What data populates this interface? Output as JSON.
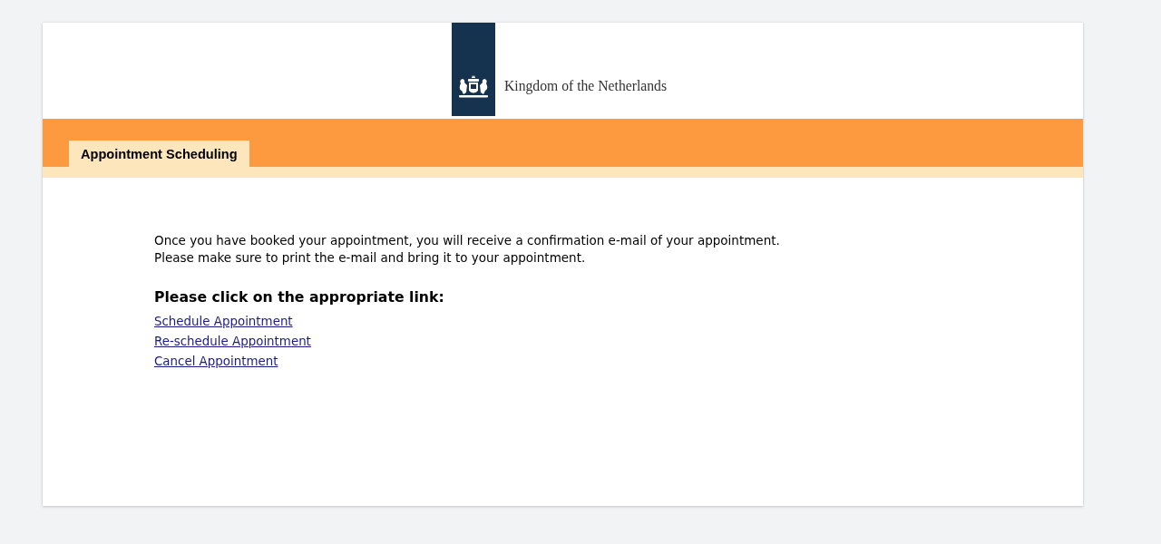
{
  "header": {
    "logo_text": "Kingdom of the Netherlands"
  },
  "tabs": [
    {
      "label": "Appointment Scheduling",
      "selected": true
    }
  ],
  "intro": [
    "Once you have booked your appointment, you will receive a confirmation e-mail of your appointment.",
    "Please make sure to print the e-mail and bring it to your appointment."
  ],
  "heading": "Please click on the appropriate link:",
  "links": [
    "Schedule Appointment",
    "Re-schedule Appointment",
    "Cancel Appointment"
  ]
}
